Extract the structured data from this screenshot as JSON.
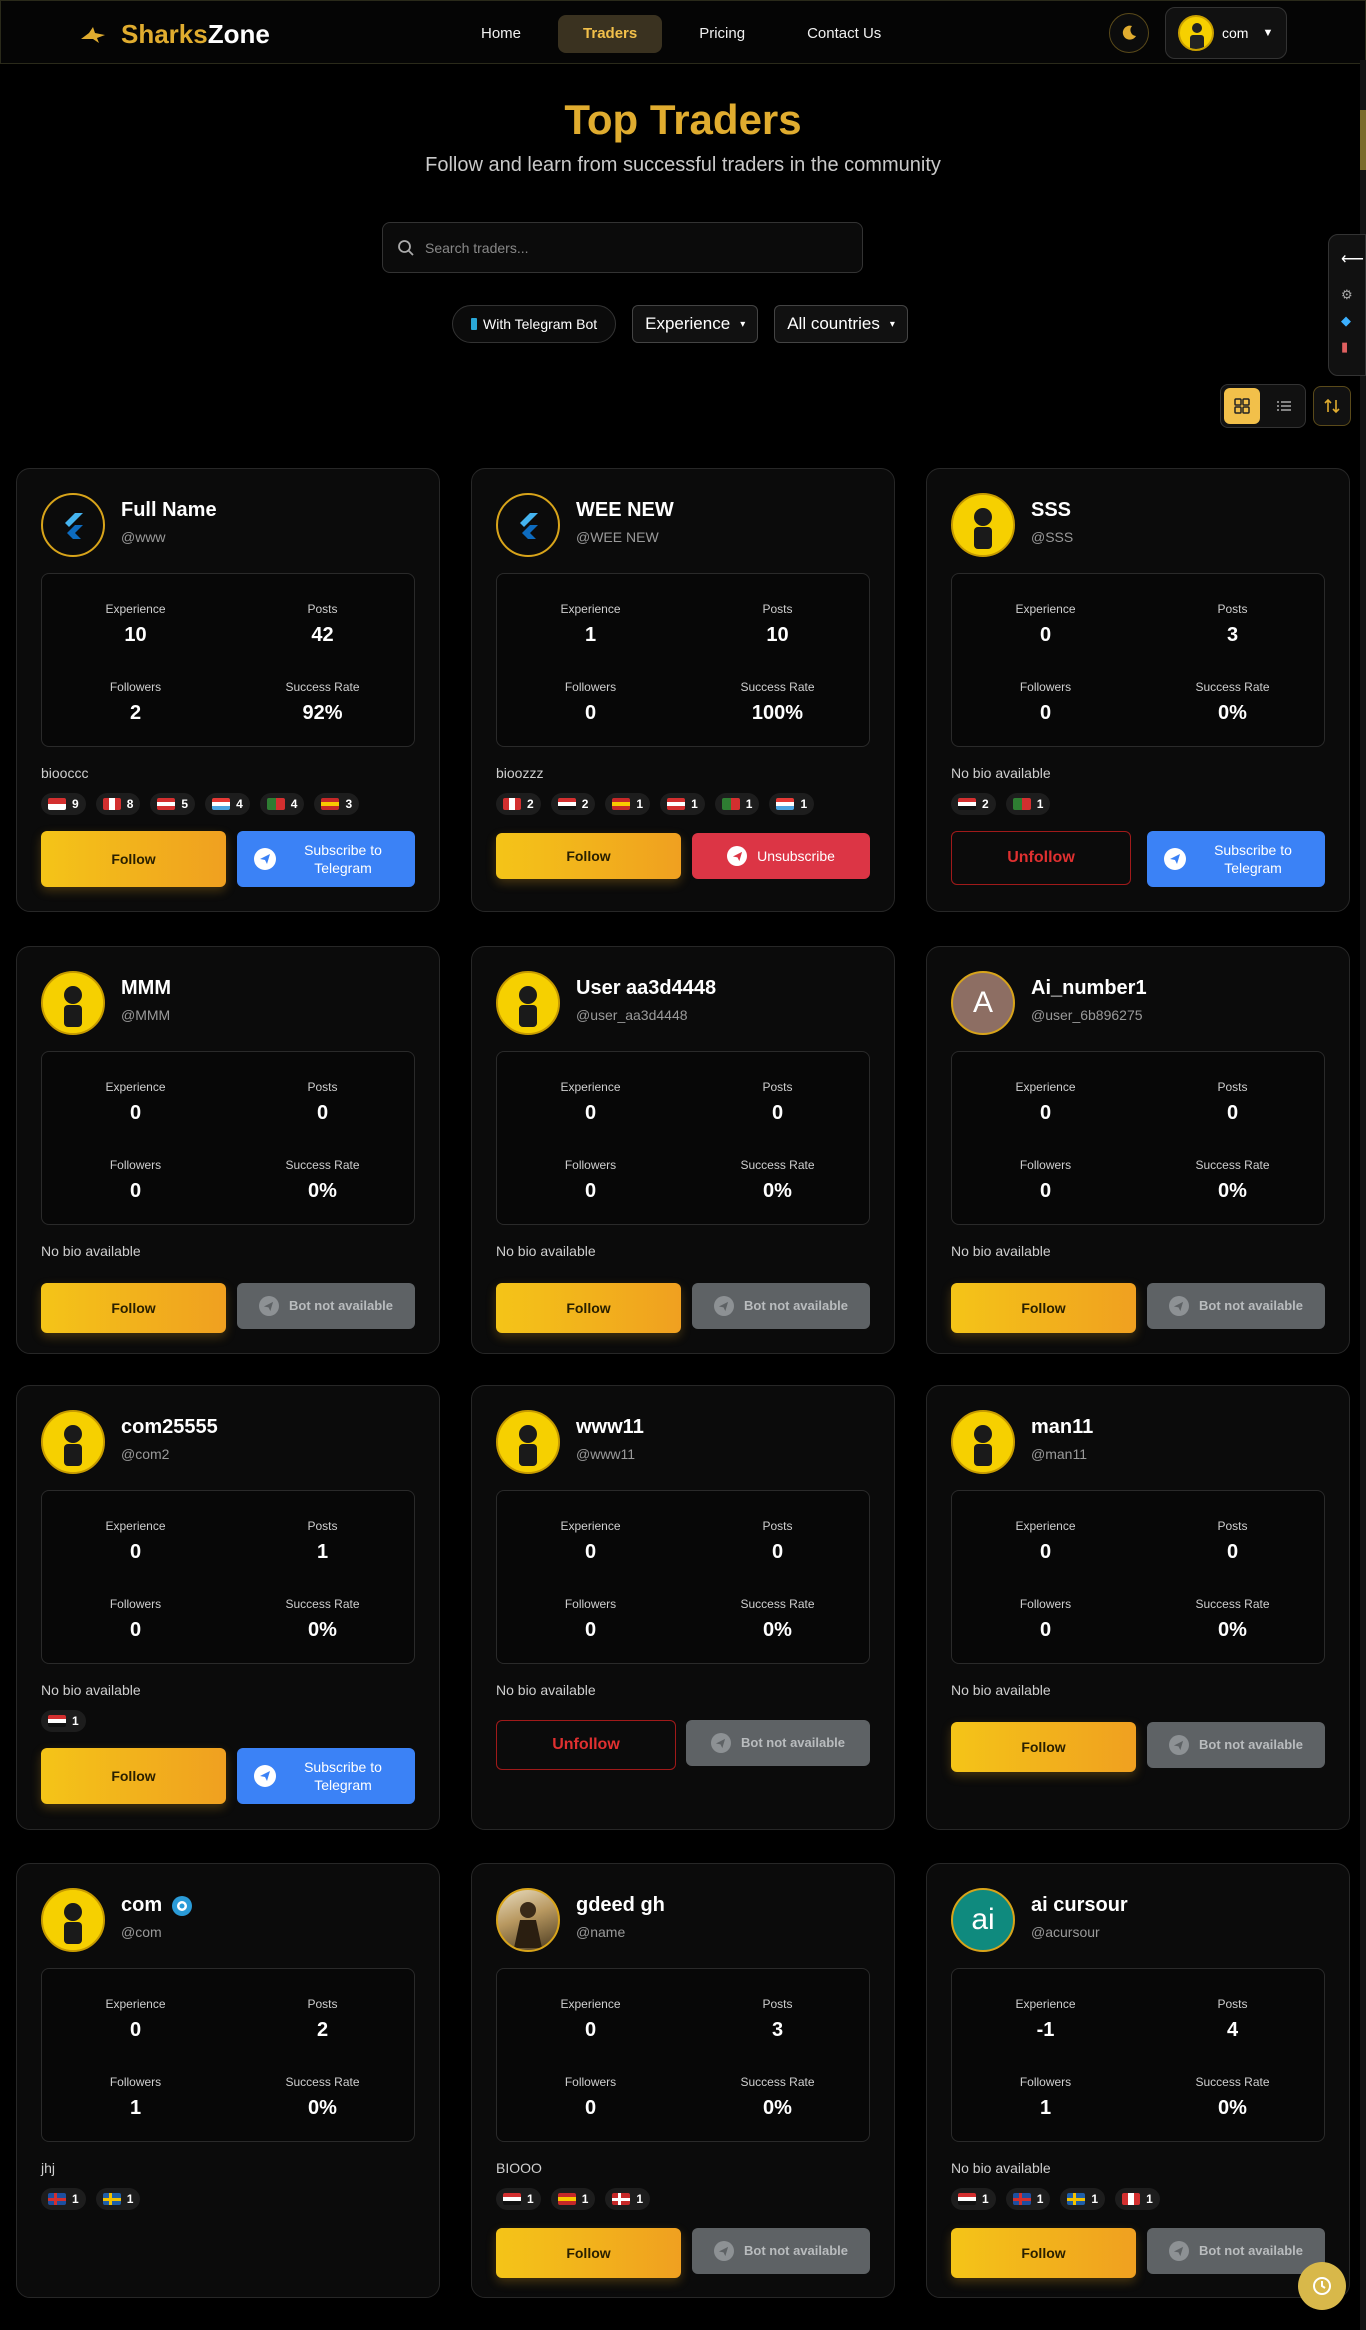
{
  "brand": {
    "part1": "Sharks",
    "part2": "Zone"
  },
  "nav": {
    "items": [
      {
        "label": "Home",
        "active": false
      },
      {
        "label": "Traders",
        "active": true
      },
      {
        "label": "Pricing",
        "active": false
      },
      {
        "label": "Contact Us",
        "active": false
      }
    ]
  },
  "user_menu": {
    "name": "com"
  },
  "hero": {
    "title": "Top Traders",
    "subtitle": "Follow and learn from successful traders in the community"
  },
  "search": {
    "placeholder": "Search traders..."
  },
  "filters": {
    "telegram_pill": "With Telegram Bot",
    "sort_select": "Experience",
    "country_select": "All countries"
  },
  "labels": {
    "experience": "Experience",
    "posts": "Posts",
    "followers": "Followers",
    "success_rate": "Success Rate",
    "follow": "Follow",
    "unfollow": "Unfollow",
    "subscribe": "Subscribe to Telegram",
    "unsubscribe": "Unsubscribe",
    "bot_na": "Bot not available"
  },
  "colors": {
    "accent": "#e0ac2f",
    "follow_gradient_start": "#f4c418",
    "follow_gradient_end": "#f0a020",
    "telegram_blue": "#3b82f6",
    "danger": "#dc3545",
    "disabled": "#5e6265"
  },
  "traders": [
    {
      "name": "Full Name",
      "handle": "@www",
      "avatar": "flutter",
      "experience": "10",
      "posts": "42",
      "followers": "2",
      "success_rate": "92%",
      "bio": "biooccc",
      "countries": [
        {
          "flag": "id",
          "count": "9"
        },
        {
          "flag": "ca",
          "count": "8"
        },
        {
          "flag": "at",
          "count": "5"
        },
        {
          "flag": "lu",
          "count": "4"
        },
        {
          "flag": "pt",
          "count": "4"
        },
        {
          "flag": "es",
          "count": "3"
        }
      ],
      "action": "follow",
      "telegram": "subscribe"
    },
    {
      "name": "WEE NEW",
      "handle": "@WEE NEW",
      "avatar": "flutter",
      "experience": "1",
      "posts": "10",
      "followers": "0",
      "success_rate": "100%",
      "bio": "bioozzz",
      "countries": [
        {
          "flag": "ca",
          "count": "2"
        },
        {
          "flag": "eg",
          "count": "2"
        },
        {
          "flag": "es",
          "count": "1"
        },
        {
          "flag": "at",
          "count": "1"
        },
        {
          "flag": "pt",
          "count": "1"
        },
        {
          "flag": "lu",
          "count": "1"
        }
      ],
      "action": "follow",
      "telegram": "unsubscribe"
    },
    {
      "name": "SSS",
      "handle": "@SSS",
      "avatar": "default",
      "experience": "0",
      "posts": "3",
      "followers": "0",
      "success_rate": "0%",
      "bio": "No bio available",
      "countries": [
        {
          "flag": "eg",
          "count": "2"
        },
        {
          "flag": "pt",
          "count": "1"
        }
      ],
      "action": "unfollow",
      "telegram": "subscribe"
    },
    {
      "name": "MMM",
      "handle": "@MMM",
      "avatar": "default",
      "experience": "0",
      "posts": "0",
      "followers": "0",
      "success_rate": "0%",
      "bio": "No bio available",
      "countries": [],
      "action": "follow",
      "telegram": "na"
    },
    {
      "name": "User aa3d4448",
      "handle": "@user_aa3d4448",
      "avatar": "default",
      "experience": "0",
      "posts": "0",
      "followers": "0",
      "success_rate": "0%",
      "bio": "No bio available",
      "countries": [],
      "action": "follow",
      "telegram": "na"
    },
    {
      "name": "Ai_number1",
      "handle": "@user_6b896275",
      "avatar": "letter",
      "letter": "A",
      "avatar_color": "#8d6e63",
      "experience": "0",
      "posts": "0",
      "followers": "0",
      "success_rate": "0%",
      "bio": "No bio available",
      "countries": [],
      "action": "follow",
      "telegram": "na"
    },
    {
      "name": "com25555",
      "handle": "@com2",
      "avatar": "default",
      "experience": "0",
      "posts": "1",
      "followers": "0",
      "success_rate": "0%",
      "bio": "No bio available",
      "countries": [
        {
          "flag": "eg",
          "count": "1"
        }
      ],
      "action": "follow",
      "telegram": "subscribe"
    },
    {
      "name": "www11",
      "handle": "@www11",
      "avatar": "default",
      "experience": "0",
      "posts": "0",
      "followers": "0",
      "success_rate": "0%",
      "bio": "No bio available",
      "countries": [],
      "action": "unfollow",
      "telegram": "na"
    },
    {
      "name": "man11",
      "handle": "@man11",
      "avatar": "default",
      "experience": "0",
      "posts": "0",
      "followers": "0",
      "success_rate": "0%",
      "bio": "No bio available",
      "countries": [],
      "action": "follow",
      "telegram": "na"
    },
    {
      "name": "com",
      "handle": "@com",
      "avatar": "default",
      "verified": true,
      "experience": "0",
      "posts": "2",
      "followers": "1",
      "success_rate": "0%",
      "bio": "jhj",
      "countries": [
        {
          "flag": "is",
          "count": "1"
        },
        {
          "flag": "se",
          "count": "1"
        }
      ],
      "action": "none",
      "telegram": "none"
    },
    {
      "name": "gdeed gh",
      "handle": "@name",
      "avatar": "photo",
      "experience": "0",
      "posts": "3",
      "followers": "0",
      "success_rate": "0%",
      "bio": "BIOOO",
      "countries": [
        {
          "flag": "eg",
          "count": "1"
        },
        {
          "flag": "es",
          "count": "1"
        },
        {
          "flag": "no",
          "count": "1"
        }
      ],
      "action": "follow",
      "telegram": "na"
    },
    {
      "name": "ai cursour",
      "handle": "@acursour",
      "avatar": "letter",
      "letter": "ai",
      "avatar_color": "#0f8a7e",
      "experience": "-1",
      "posts": "4",
      "followers": "1",
      "success_rate": "0%",
      "bio": "No bio available",
      "countries": [
        {
          "flag": "eg",
          "count": "1"
        },
        {
          "flag": "is",
          "count": "1"
        },
        {
          "flag": "se",
          "count": "1"
        },
        {
          "flag": "ca",
          "count": "1"
        }
      ],
      "action": "follow",
      "telegram": "na"
    }
  ]
}
